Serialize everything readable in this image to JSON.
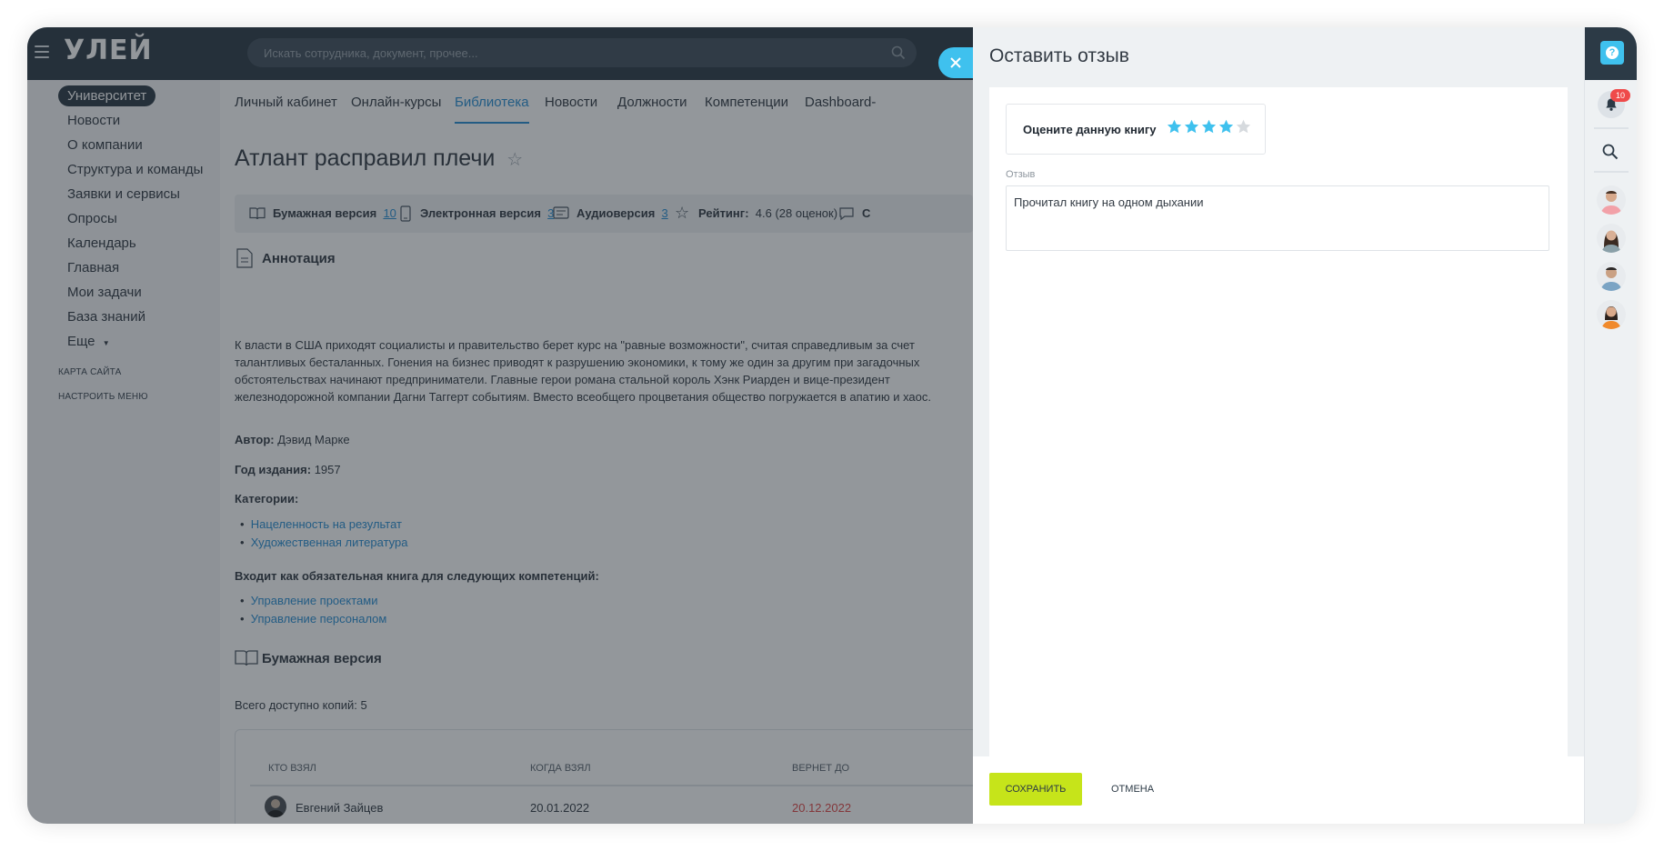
{
  "app": {
    "logo": "УЛЕЙ"
  },
  "search": {
    "placeholder": "Искать сотрудника, документ, прочее..."
  },
  "sidebar": {
    "items": [
      {
        "label": "Университет"
      },
      {
        "label": "Новости"
      },
      {
        "label": "О компании"
      },
      {
        "label": "Структура и команды"
      },
      {
        "label": "Заявки и сервисы"
      },
      {
        "label": "Опросы"
      },
      {
        "label": "Календарь"
      },
      {
        "label": "Главная"
      },
      {
        "label": "Мои задачи"
      },
      {
        "label": "База знаний"
      },
      {
        "label": "Еще"
      }
    ],
    "links": [
      {
        "label": "Карта сайта"
      },
      {
        "label": "Настроить меню"
      }
    ]
  },
  "nav": {
    "tabs": [
      {
        "label": "Личный кабинет"
      },
      {
        "label": "Онлайн-курсы"
      },
      {
        "label": "Библиотека"
      },
      {
        "label": "Новости"
      },
      {
        "label": "Должности"
      },
      {
        "label": "Компетенции"
      },
      {
        "label": "Dashboard-"
      }
    ]
  },
  "book": {
    "title": "Атлант расправил плечи",
    "info": {
      "paper_label": "Бумажная версия",
      "paper_count": "10",
      "electronic_label": "Электронная версия",
      "electronic_count": "3",
      "audio_label": "Аудиоверсия",
      "audio_count": "3",
      "rating_label": "Рейтинг:",
      "rating_value": "4.6 (28 оценок)",
      "comments_cut": "С"
    },
    "annotation_heading": "Аннотация",
    "annotation_text": "К власти в США приходят социалисты и правительство берет курс на \"равные возможности\", считая справедливым за счет талантливых бесталанных. Гонения на бизнес приводят к разрушению экономики, к тому же один за другим при загадочных обстоятельствах начинают предприниматели. Главные герои романа стальной король Хэнк Риарден и вице-президент железнодорожной компании Дагни Таггерт событиям. Вместо всеобщего процветания общество погружается в апатию и хаос.",
    "author_label": "Автор:",
    "author_value": "Дэвид Марке",
    "year_label": "Год издания:",
    "year_value": "1957",
    "categories_label": "Категории:",
    "categories": [
      "Нацеленность на результат",
      "Художественная литература"
    ],
    "competencies_label": "Входит как обязательная книга для следующих компетенций:",
    "competencies": [
      "Управление проектами",
      "Управление персоналом"
    ],
    "paper_heading": "Бумажная версия",
    "copies_text": "Всего доступно копий: 5",
    "table": {
      "headers": [
        "Кто взял",
        "Когда взял",
        "Вернет до"
      ],
      "rows": [
        {
          "who": "Евгений Зайцев",
          "when": "20.01.2022",
          "until": "20.12.2022"
        }
      ]
    }
  },
  "panel": {
    "title": "Оставить отзыв",
    "rate_label": "Оцените данную книгу",
    "rating": 4,
    "rating_max": 5,
    "review_label": "Отзыв",
    "review_value": "Прочитал книгу на одном дыхании",
    "save_label": "Сохранить",
    "cancel_label": "Отмена"
  },
  "rail": {
    "notifications_count": "10"
  },
  "colors": {
    "accent": "#3fc1ee",
    "save": "#c6e41a",
    "star_filled": "#3fc1ee",
    "star_empty": "#d6dade",
    "link": "#2a8fd4",
    "date_overdue": "#e04848",
    "badge": "#ef4a4a"
  }
}
